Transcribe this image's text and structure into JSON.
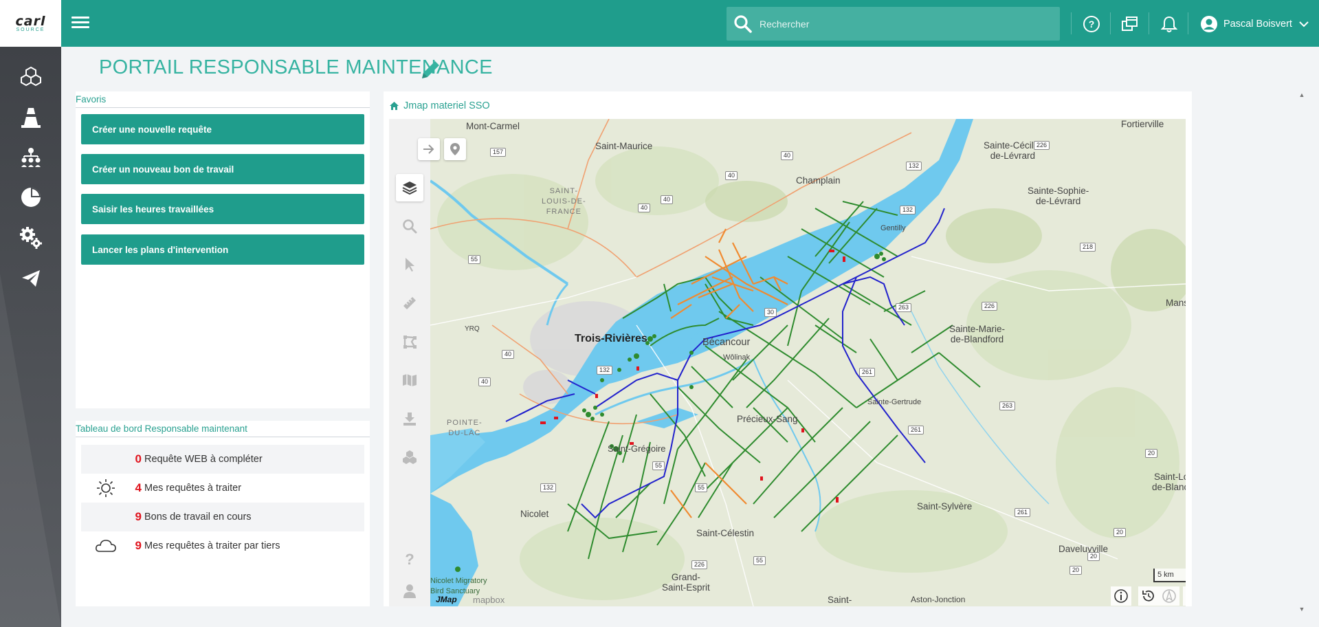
{
  "app": {
    "logo_main": "carl",
    "logo_sub": "SOURCE"
  },
  "header": {
    "search_placeholder": "Rechercher",
    "user_name": "Pascal Boisvert",
    "icons": [
      "help-icon",
      "windows-icon",
      "bell-icon",
      "user-icon"
    ]
  },
  "sidebar": {
    "items": [
      "cubes-icon",
      "traffic-cone-icon",
      "hierarchy-icon",
      "pie-chart-icon",
      "gears-icon",
      "paper-plane-icon"
    ]
  },
  "page": {
    "title": "PORTAIL RESPONSABLE MAINTENANCE"
  },
  "favoris": {
    "title": "Favoris",
    "buttons": [
      "Créer une nouvelle requête",
      "Créer un nouveau bon de travail",
      "Saisir les heures travaillées",
      "Lancer les plans d'intervention"
    ]
  },
  "dashboard": {
    "title": "Tableau de bord Responsable maintenant",
    "rows": [
      {
        "count": "0",
        "label": "Requête WEB à compléter",
        "icon": ""
      },
      {
        "count": "4",
        "label": "Mes requêtes à traiter",
        "icon": "sun-icon"
      },
      {
        "count": "9",
        "label": "Bons de travail en cours",
        "icon": ""
      },
      {
        "count": "9",
        "label": "Mes requêtes à traiter par tiers",
        "icon": "cloud-icon"
      }
    ]
  },
  "map": {
    "title": "Jmap materiel SSO",
    "scale_label": "5 km",
    "attribution_left": "JMap",
    "attribution_mapbox": "mapbox",
    "places": {
      "mont_carmel": "Mont-Carmel",
      "saint_maurice": "Saint-Maurice",
      "champlain": "Champlain",
      "fortierville": "Fortierville",
      "sainte_cecile": "Sainte-Cécile-\nde-Lévrard",
      "sainte_sophie": "Sainte-Sophie-\nde-Lévrard",
      "saint_louis": "SAINT-\nLOUIS-DE-\nFRANCE",
      "trois_rivieres": "Trois-Rivières",
      "becancour": "Bécancour",
      "wolinak": "Wôlinak",
      "yrq": "YRQ",
      "pointe_du_lac": "POINTE-\nDU-LAC",
      "gentilly": "Gentilly",
      "sainte_marie": "Sainte-Marie-\nde-Blandford",
      "sainte_gertrude": "Sainte-Gertrude",
      "precieux_sang": "Précieux-Sang",
      "saint_gregoire": "Saint-Grégoire",
      "nicolet": "Nicolet",
      "saint_celestin": "Saint-Célestin",
      "saint_sylvere": "Saint-Sylvère",
      "grand_saint_esprit": "Grand-\nSaint-Esprit",
      "daveluyville": "Daveluyville",
      "aston_jonction": "Aston-Jonction",
      "saint_bottom": "Saint-",
      "nicolet_migratory": "Nicolet Migratory\nBird Sanctuary",
      "manse": "Manse",
      "saint_lo": "Saint-Lo\nde-Blanc"
    },
    "shields": {
      "s157": "157",
      "s40a": "40",
      "s40b": "40",
      "s40c": "40",
      "s40d": "40",
      "s40e": "40",
      "s40f": "40",
      "s132a": "132",
      "s132b": "132",
      "s132c": "132",
      "s132d": "132",
      "s226a": "226",
      "s226b": "226",
      "s218": "218",
      "s55a": "55",
      "s55b": "55",
      "s55c": "55",
      "s55d": "55",
      "s263a": "263",
      "s263b": "263",
      "s261a": "261",
      "s261b": "261",
      "s261c": "261",
      "s20a": "20",
      "s20b": "20",
      "s20c": "20",
      "s20d": "20",
      "s30": "30",
      "s226c": "226"
    },
    "tools": [
      "layers-icon",
      "search-icon",
      "pointer-icon",
      "ruler-icon",
      "draw-polygon-icon",
      "map-icon",
      "download-icon",
      "cubes-icon",
      "question-icon",
      "user-icon"
    ]
  },
  "colors": {
    "brand": "#1f9d8c",
    "title": "#36b3a1",
    "count": "#e0141e",
    "water": "#6fc9ee",
    "network_green": "#2e8b2e",
    "network_blue": "#2222cc",
    "network_orange": "#f08a30"
  }
}
